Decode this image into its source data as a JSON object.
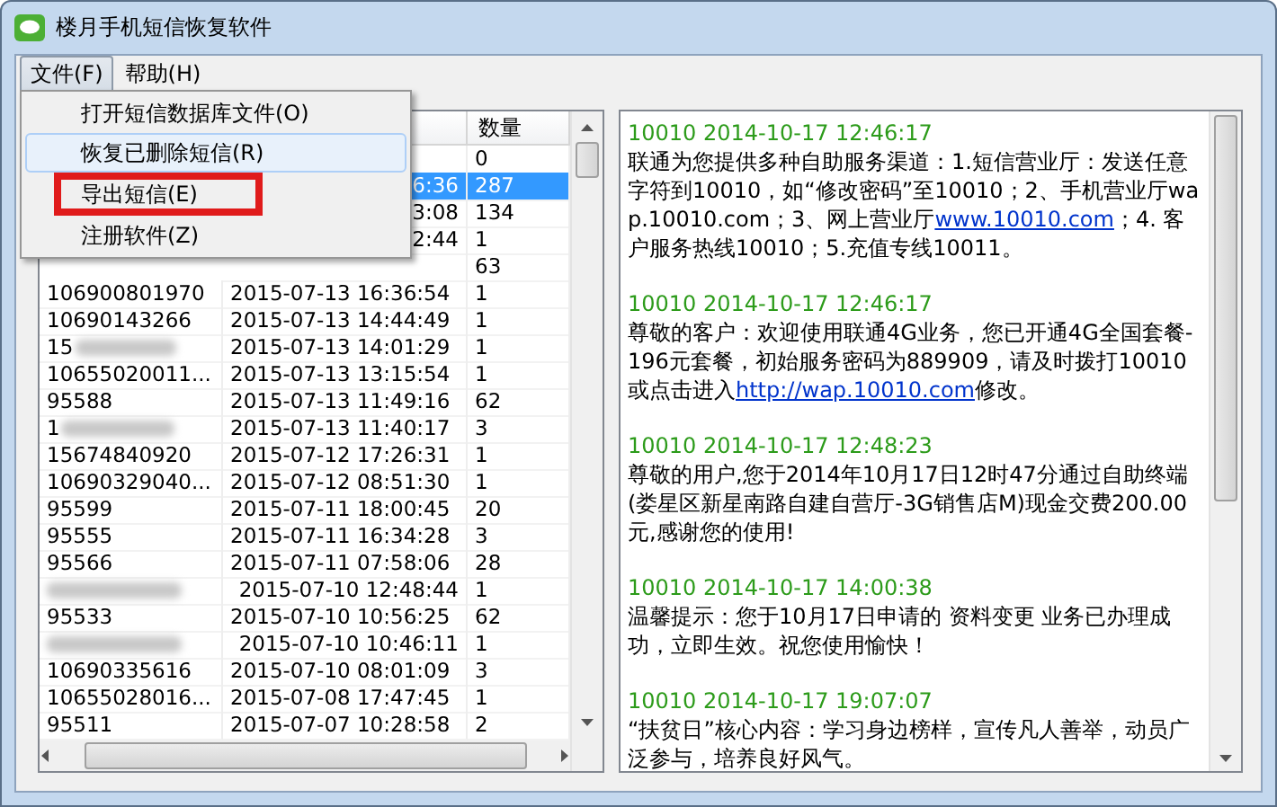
{
  "window": {
    "title": "楼月手机短信恢复软件"
  },
  "menu_bar": [
    {
      "label": "文件(F)",
      "selected": true
    },
    {
      "label": "帮助(H)",
      "selected": false
    }
  ],
  "dropdown": [
    {
      "label": "打开短信数据库文件(O)",
      "hovered": false,
      "highlighted": false
    },
    {
      "label": "恢复已删除短信(R)",
      "hovered": true,
      "highlighted": false
    },
    {
      "label": "导出短信(E)",
      "hovered": false,
      "highlighted": true
    },
    {
      "label": "注册软件(Z)",
      "hovered": false,
      "highlighted": false
    }
  ],
  "table": {
    "columns": [
      {
        "label": "数量"
      }
    ],
    "rows": [
      {
        "count": "0",
        "selected": false
      },
      {
        "time": "6:36",
        "count": "287",
        "selected": true
      },
      {
        "time": "3:08",
        "count": "134",
        "selected": false
      },
      {
        "time": "2:44",
        "count": "1",
        "selected": false
      },
      {
        "count": "63",
        "selected": false
      },
      {
        "number": "106900801970",
        "time": "2015-07-13 16:36:54",
        "count": "1",
        "selected": false
      },
      {
        "number": "10690143266",
        "time": "2015-07-13 14:44:49",
        "count": "1",
        "selected": false
      },
      {
        "number": "15",
        "blurred": true,
        "time": "2015-07-13 14:01:29",
        "count": "1",
        "selected": false
      },
      {
        "number": "10655020011...",
        "time": "2015-07-13 13:15:54",
        "count": "1",
        "selected": false
      },
      {
        "number": "95588",
        "time": "2015-07-13 11:49:16",
        "count": "62",
        "selected": false
      },
      {
        "number": "1",
        "blurred": true,
        "time": "2015-07-13 11:40:17",
        "count": "3",
        "selected": false
      },
      {
        "number": "15674840920",
        "time": "2015-07-12 17:26:31",
        "count": "1",
        "selected": false
      },
      {
        "number": "10690329040...",
        "time": "2015-07-12 08:51:30",
        "count": "1",
        "selected": false
      },
      {
        "number": "95599",
        "time": "2015-07-11 18:00:45",
        "count": "20",
        "selected": false
      },
      {
        "number": "95555",
        "time": "2015-07-11 16:34:28",
        "count": "3",
        "selected": false
      },
      {
        "number": "95566",
        "time": "2015-07-11 07:58:06",
        "count": "28",
        "selected": false
      },
      {
        "blurred": true,
        "time": "2015-07-10 12:48:44",
        "count": "1",
        "selected": false
      },
      {
        "number": "95533",
        "time": "2015-07-10 10:56:25",
        "count": "62",
        "selected": false
      },
      {
        "blurred": true,
        "time": "2015-07-10 10:46:11",
        "count": "1",
        "selected": false
      },
      {
        "number": "10690335616",
        "time": "2015-07-10 08:01:09",
        "count": "3",
        "selected": false
      },
      {
        "number": "10655028016...",
        "time": "2015-07-08 17:47:45",
        "count": "1",
        "selected": false
      },
      {
        "number": "95511",
        "time": "2015-07-07 10:28:58",
        "count": "2",
        "selected": false
      }
    ]
  },
  "messages": [
    {
      "header": "10010 2014-10-17 12:46:17",
      "body": [
        {
          "kind": "text",
          "text": "联通为您提供多种自助服务渠道：1.短信营业厅：发送任意字符到10010，如“修改密码”至10010；2、手机营业厅wap.10010.com；3、网上营业厅"
        },
        {
          "kind": "link",
          "text": "www.10010.com"
        },
        {
          "kind": "text",
          "text": "；4. 客户服务热线10010；5.充值专线10011。"
        }
      ]
    },
    {
      "header": "10010 2014-10-17 12:46:17",
      "body": [
        {
          "kind": "text",
          "text": "尊敬的客户：欢迎使用联通4G业务，您已开通4G全国套餐-196元套餐，初始服务密码为889909，请及时拨打10010或点击进入"
        },
        {
          "kind": "link",
          "text": "http://wap.10010.com"
        },
        {
          "kind": "text",
          "text": "修改。"
        }
      ]
    },
    {
      "header": "10010 2014-10-17 12:48:23",
      "body": [
        {
          "kind": "text",
          "text": "尊敬的用户,您于2014年10月17日12时47分通过自助终端(娄星区新星南路自建自营厅-3G销售店M)现金交费200.00元,感谢您的使用!"
        }
      ]
    },
    {
      "header": "10010 2014-10-17 14:00:38",
      "body": [
        {
          "kind": "text",
          "text": "温馨提示：您于10月17日申请的 资料变更 业务已办理成功，立即生效。祝您使用愉快！"
        }
      ]
    },
    {
      "header": "10010 2014-10-17 19:07:07",
      "body": [
        {
          "kind": "text",
          "text": "“扶贫日”核心内容：学习身边榜样，宣传凡人善举，动员广泛参与，培养良好风气。"
        }
      ]
    }
  ]
}
